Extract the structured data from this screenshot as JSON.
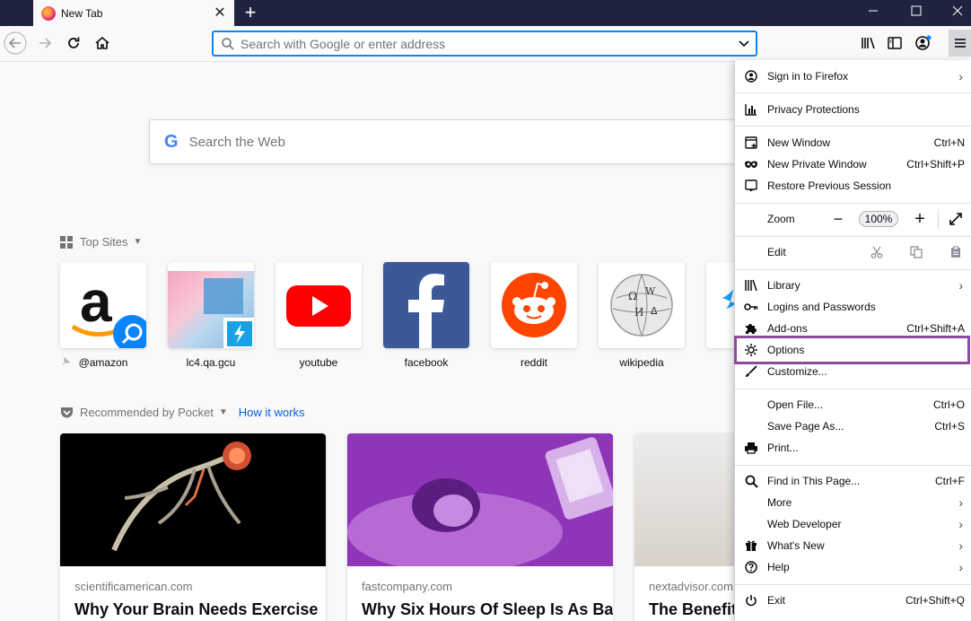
{
  "browser": {
    "tab_title": "New Tab",
    "url_placeholder": "Search with Google or enter address"
  },
  "newtab": {
    "search_placeholder": "Search the Web",
    "google_letter": "G",
    "top_sites_title": "Top Sites",
    "top_sites": [
      {
        "label": "@amazon",
        "color": "#ffffff"
      },
      {
        "label": "lc4.qa.gcu",
        "color": "#e8f0f8"
      },
      {
        "label": "youtube",
        "color": "#ffffff"
      },
      {
        "label": "facebook",
        "color": "#3b5998"
      },
      {
        "label": "reddit",
        "color": "#ffffff"
      },
      {
        "label": "wikipedia",
        "color": "#ffffff"
      }
    ],
    "pocket_title": "Recommended by Pocket",
    "pocket_link": "How it works",
    "stories": [
      {
        "source": "scientificamerican.com",
        "headline": "Why Your Brain Needs Exercise"
      },
      {
        "source": "fastcompany.com",
        "headline": "Why Six Hours Of Sleep Is As Bad"
      },
      {
        "source": "nextadvisor.com",
        "headline": "The Benefits"
      }
    ]
  },
  "menu": {
    "sign_in": "Sign in to Firefox",
    "privacy": "Privacy Protections",
    "new_window": {
      "label": "New Window",
      "shortcut": "Ctrl+N"
    },
    "new_private": {
      "label": "New Private Window",
      "shortcut": "Ctrl+Shift+P"
    },
    "restore": "Restore Previous Session",
    "zoom": {
      "label": "Zoom",
      "value": "100%",
      "minus": "−",
      "plus": "+"
    },
    "edit": "Edit",
    "library": "Library",
    "logins": "Logins and Passwords",
    "addons": {
      "label": "Add-ons",
      "shortcut": "Ctrl+Shift+A"
    },
    "options": "Options",
    "customize": "Customize...",
    "open_file": {
      "label": "Open File...",
      "shortcut": "Ctrl+O"
    },
    "save_page": {
      "label": "Save Page As...",
      "shortcut": "Ctrl+S"
    },
    "print": "Print...",
    "find": {
      "label": "Find in This Page...",
      "shortcut": "Ctrl+F"
    },
    "more": "More",
    "webdev": "Web Developer",
    "whatsnew": "What's New",
    "help": "Help",
    "exit": {
      "label": "Exit",
      "shortcut": "Ctrl+Shift+Q"
    }
  },
  "colors": {
    "accent": "#0a84ff",
    "highlight": "#8f4aa0",
    "titlebar": "#202340"
  }
}
